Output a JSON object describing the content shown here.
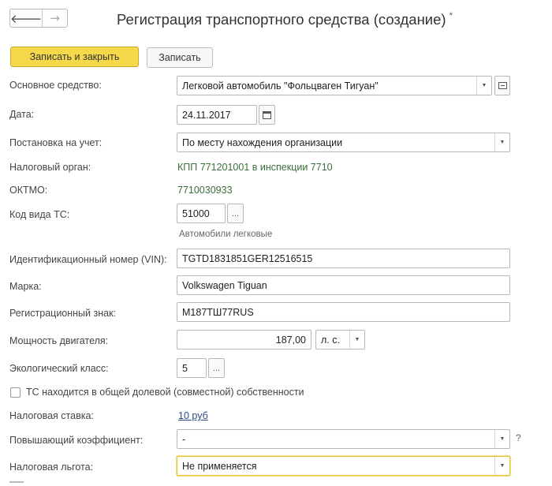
{
  "window": {
    "title": "Регистрация транспортного средства (создание)",
    "modified_marker": "*"
  },
  "nav": {
    "back_glyph": "🡐",
    "forward_glyph": "→"
  },
  "toolbar": {
    "save_close": "Записать и закрыть",
    "save": "Записать"
  },
  "form": {
    "asset": {
      "label": "Основное средство:",
      "value": "Легковой автомобиль \"Фольцваген Тигуан\""
    },
    "date": {
      "label": "Дата:",
      "value": "24.11.2017"
    },
    "registration": {
      "label": "Постановка на учет:",
      "value": "По месту нахождения организации"
    },
    "tax_authority": {
      "label": "Налоговый орган:",
      "value": "КПП 771201001 в инспекции 7710"
    },
    "oktmo": {
      "label": "ОКТМО:",
      "value": "7710030933"
    },
    "vehicle_code": {
      "label": "Код вида ТС:",
      "value": "51000",
      "hint": "Автомобили легковые"
    },
    "vin": {
      "label": "Идентификационный номер (VIN):",
      "value": "TGTD1831851GER12516515"
    },
    "brand": {
      "label": "Марка:",
      "value": "Volkswagen Tiguan"
    },
    "reg_sign": {
      "label": "Регистрационный знак:",
      "value": "М187ТШ77RUS"
    },
    "power": {
      "label": "Мощность двигателя:",
      "value": "187,00",
      "unit": "л. с."
    },
    "eco_class": {
      "label": "Экологический класс:",
      "value": "5"
    },
    "shared_ownership": {
      "label": "ТС находится в общей долевой (совместной) собственности",
      "checked": false
    },
    "tax_rate": {
      "label": "Налоговая ставка:",
      "value": "10 руб"
    },
    "coefficient": {
      "label": "Повышающий коэффициент:",
      "value": "-",
      "help": "?"
    },
    "tax_benefit": {
      "label": "Налоговая льгота:",
      "value": "Не применяется"
    }
  },
  "icons": {
    "dropdown": "▼",
    "open": "⊡",
    "calendar": "calendar-icon",
    "select": "..."
  }
}
